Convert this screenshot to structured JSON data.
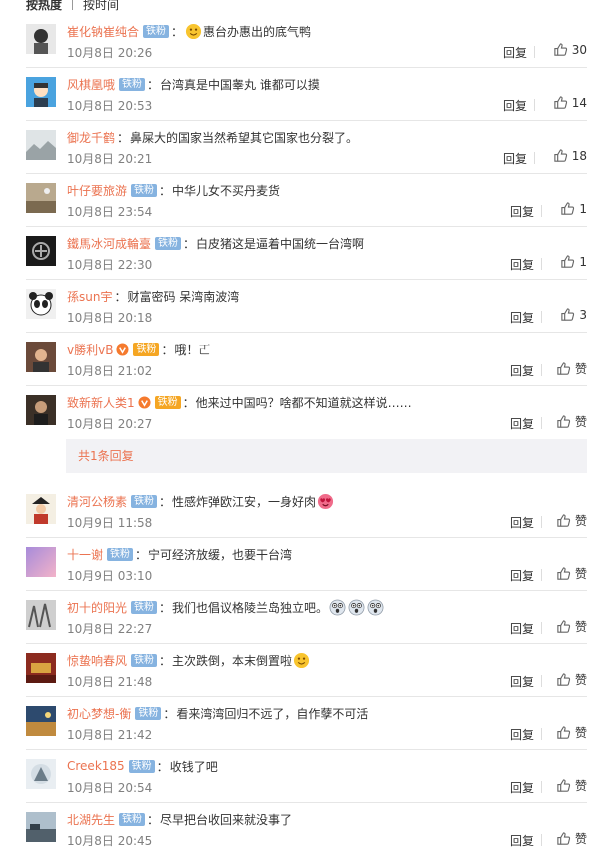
{
  "sort": {
    "hot": "按热度",
    "time": "按时间"
  },
  "reply_label": "回复",
  "like_label_zero": "赞",
  "badge_label": "铁粉",
  "more_replies_label": "共1条回复",
  "comments": [
    {
      "user": "崔化钠崔纯合",
      "badge": true,
      "vip": false,
      "text": "惠台办惠出的底气鸭",
      "emoji_before": [
        "smile"
      ],
      "emoji_after": [],
      "time": "10月8日 20:26",
      "likes": "30"
    },
    {
      "user": "风棋凰哦",
      "badge": true,
      "vip": false,
      "text": "台湾真是中国睾丸 谁都可以摸",
      "emoji_before": [],
      "emoji_after": [],
      "time": "10月8日 20:53",
      "likes": "14"
    },
    {
      "user": "御龙千鹤",
      "badge": false,
      "vip": false,
      "text": "鼻屎大的国家当然希望其它国家也分裂了。",
      "emoji_before": [],
      "emoji_after": [],
      "time": "10月8日 20:21",
      "likes": "18"
    },
    {
      "user": "叶仔要旅游",
      "badge": true,
      "vip": false,
      "text": "中华儿女不买丹麦货",
      "emoji_before": [],
      "emoji_after": [],
      "time": "10月8日 23:54",
      "likes": "1"
    },
    {
      "user": "鐵馬冰河成輪臺",
      "badge": true,
      "vip": false,
      "text": "白皮猪这是逼着中国统一台湾啊",
      "emoji_before": [],
      "emoji_after": [],
      "time": "10月8日 22:30",
      "likes": "1"
    },
    {
      "user": "孫sun宇",
      "badge": false,
      "vip": false,
      "text": "财富密码 呆湾南波湾",
      "emoji_before": [],
      "emoji_after": [],
      "time": "10月8日 20:18",
      "likes": "3"
    },
    {
      "user": "v勝利vB",
      "badge": true,
      "vip": true,
      "text": "哦！𠀀",
      "emoji_before": [],
      "emoji_after": [],
      "time": "10月8日 21:02",
      "likes": ""
    },
    {
      "user": "致新新人类1",
      "badge": true,
      "vip": true,
      "text": "他来过中国吗？啥都不知道就这样说……",
      "emoji_before": [],
      "emoji_after": [],
      "time": "10月8日 20:27",
      "likes": ""
    },
    {
      "user": "清河公杨素",
      "badge": true,
      "vip": false,
      "text": "性感炸弹欧江安，一身好肉",
      "emoji_before": [],
      "emoji_after": [
        "heart-eyes"
      ],
      "time": "10月9日 11:58",
      "likes": ""
    },
    {
      "user": "十一谢",
      "badge": true,
      "vip": false,
      "text": "宁可经济放缓，也要干台湾",
      "emoji_before": [],
      "emoji_after": [],
      "time": "10月9日 03:10",
      "likes": ""
    },
    {
      "user": "初十的阳光",
      "badge": true,
      "vip": false,
      "text": "我们也倡议格陵兰岛独立吧。",
      "emoji_before": [],
      "emoji_after": [
        "shock",
        "shock",
        "shock"
      ],
      "time": "10月8日 22:27",
      "likes": ""
    },
    {
      "user": "惊蛰响春风",
      "badge": true,
      "vip": false,
      "text": "主次跌倒，本末倒置啦",
      "emoji_before": [],
      "emoji_after": [
        "smile"
      ],
      "time": "10月8日 21:48",
      "likes": ""
    },
    {
      "user": "初心梦想-衡",
      "badge": true,
      "vip": false,
      "text": "看来湾湾回归不远了，自作孽不可活",
      "emoji_before": [],
      "emoji_after": [],
      "time": "10月8日 21:42",
      "likes": ""
    },
    {
      "user": "Creek185",
      "badge": true,
      "vip": false,
      "text": "收钱了吧",
      "emoji_before": [],
      "emoji_after": [],
      "time": "10月8日 20:54",
      "likes": ""
    },
    {
      "user": "北湖先生",
      "badge": true,
      "vip": false,
      "text": "尽早把台收回来就没事了",
      "emoji_before": [],
      "emoji_after": [],
      "time": "10月8日 20:45",
      "likes": ""
    }
  ],
  "colors": {
    "username": "#eb7350",
    "badge": "#86b3e0",
    "time": "#808080",
    "divider": "#e6e6e6"
  }
}
